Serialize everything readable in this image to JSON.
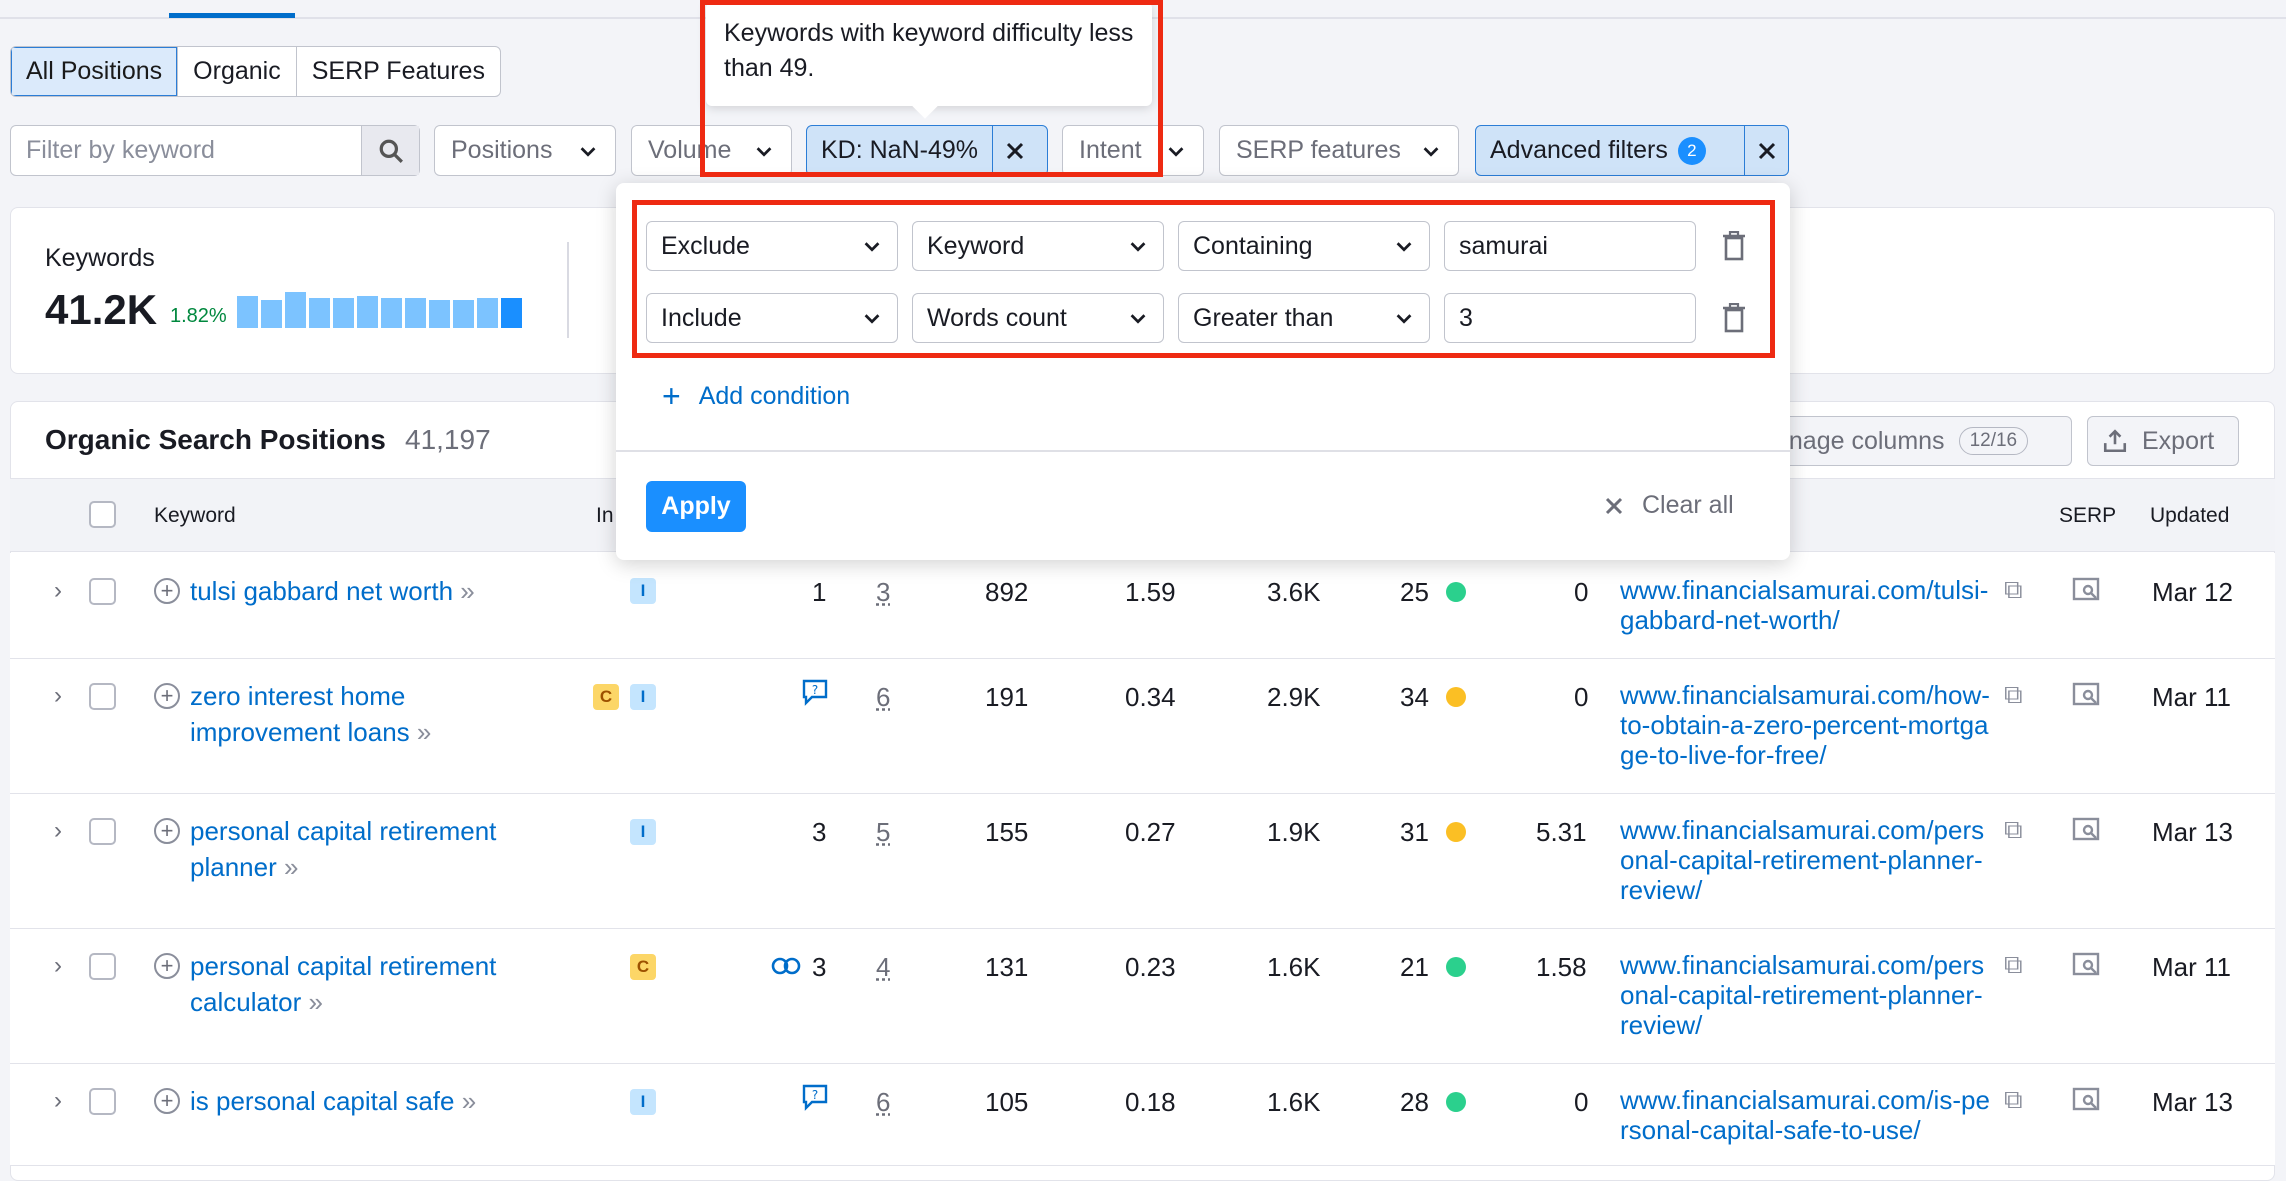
{
  "tabs": [
    {
      "label": "All Positions",
      "active": true
    },
    {
      "label": "Organic",
      "active": false
    },
    {
      "label": "SERP Features",
      "active": false
    }
  ],
  "filters": {
    "search_placeholder": "Filter by keyword",
    "positions": "Positions",
    "volume": "Volume",
    "kd_chip": "KD: NaN-49%",
    "intent": "Intent",
    "serp_features": "SERP features",
    "advanced": "Advanced filters",
    "advanced_count": "2"
  },
  "tooltip": {
    "text": "Keywords with keyword difficulty less than 49."
  },
  "advanced_panel": {
    "conditions": [
      {
        "mode": "Exclude",
        "field": "Keyword",
        "operator": "Containing",
        "value": "samurai"
      },
      {
        "mode": "Include",
        "field": "Words count",
        "operator": "Greater than",
        "value": "3"
      }
    ],
    "add_condition": "Add condition",
    "apply": "Apply",
    "clear_all": "Clear all"
  },
  "summary": {
    "label": "Keywords",
    "value": "41.2K",
    "change": "1.82%"
  },
  "table": {
    "title": "Organic Search Positions",
    "count": "41,197",
    "manage_columns": "anage columns",
    "columns_count": "12/16",
    "export": "Export",
    "headers": {
      "keyword": "Keyword",
      "intent": "In",
      "serp": "SERP",
      "updated": "Updated"
    },
    "rows": [
      {
        "kw": "tulsi gabbard net worth",
        "intents": [
          "I"
        ],
        "feature": "",
        "pos": "1",
        "results": "3",
        "vol": "892",
        "cpc": "1.59",
        "traffic": "3.6K",
        "kd": "25",
        "kd_color": "#2bd08d",
        "com": "0",
        "url": "www.financialsamurai.com/tulsi-gabbard-net-worth/",
        "updated": "Mar 12"
      },
      {
        "kw": "zero interest home improvement loans",
        "intents": [
          "C",
          "I"
        ],
        "feature": "chat",
        "pos": "",
        "results": "6",
        "vol": "191",
        "cpc": "0.34",
        "traffic": "2.9K",
        "kd": "34",
        "kd_color": "#fbbf24",
        "com": "0",
        "url": "www.financialsamurai.com/how-to-obtain-a-zero-percent-mortgage-to-live-for-free/",
        "updated": "Mar 11"
      },
      {
        "kw": "personal capital retirement planner",
        "intents": [
          "I"
        ],
        "feature": "",
        "pos": "3",
        "results": "5",
        "vol": "155",
        "cpc": "0.27",
        "traffic": "1.9K",
        "kd": "31",
        "kd_color": "#fbbf24",
        "com": "5.31",
        "url": "www.financialsamurai.com/personal-capital-retirement-planner-review/",
        "updated": "Mar 13"
      },
      {
        "kw": "personal capital retirement calculator",
        "intents": [
          "C"
        ],
        "feature": "link",
        "pos": "3",
        "results": "4",
        "vol": "131",
        "cpc": "0.23",
        "traffic": "1.6K",
        "kd": "21",
        "kd_color": "#2bd08d",
        "com": "1.58",
        "url": "www.financialsamurai.com/personal-capital-retirement-planner-review/",
        "updated": "Mar 11"
      },
      {
        "kw": "is personal capital safe",
        "intents": [
          "I"
        ],
        "feature": "chat",
        "pos": "",
        "results": "6",
        "vol": "105",
        "cpc": "0.18",
        "traffic": "1.6K",
        "kd": "28",
        "kd_color": "#2bd08d",
        "com": "0",
        "url": "www.financialsamurai.com/is-personal-capital-safe-to-use/",
        "updated": "Mar 13"
      }
    ]
  }
}
